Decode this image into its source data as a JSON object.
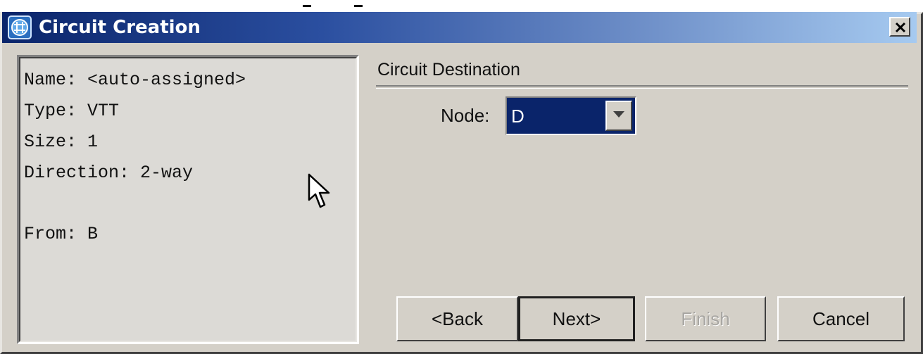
{
  "window": {
    "title": "Circuit Creation",
    "close_label": "×"
  },
  "summary": {
    "name": "Name: <auto-assigned>",
    "type": "Type: VTT",
    "size": "Size: 1",
    "direction": "Direction: 2-way",
    "from": "From: B"
  },
  "destination": {
    "section_title": "Circuit Destination",
    "node_label": "Node:",
    "node_value": "D"
  },
  "buttons": {
    "back": "<Back",
    "next": "Next>",
    "finish": "Finish",
    "cancel": "Cancel"
  },
  "colors": {
    "titlebar_start": "#0a246a",
    "titlebar_end": "#a6caf0",
    "selection": "#0a246a",
    "dialog_face": "#d4d0c8",
    "disabled_text": "#a8a6a2"
  },
  "icons": {
    "title": "circuit-app-icon",
    "close": "close-icon",
    "dropdown": "chevron-down-icon",
    "pointer": "mouse-cursor-icon"
  }
}
